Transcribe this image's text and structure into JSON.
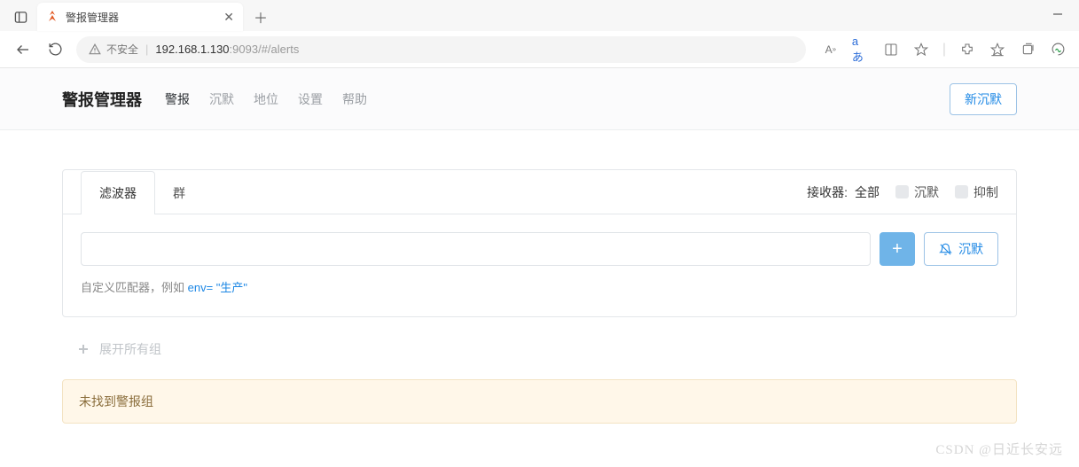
{
  "browser": {
    "tab_title": "警报管理器",
    "insecure_label": "不安全",
    "url_host": "192.168.1.130",
    "url_rest": ":9093/#/alerts",
    "text_size_label": "A",
    "translate_label": "aあ"
  },
  "nav": {
    "brand": "警报管理器",
    "links": {
      "alerts": "警报",
      "silences": "沉默",
      "status": "地位",
      "settings": "设置",
      "help": "帮助"
    },
    "new_silence": "新沉默"
  },
  "card": {
    "tab_filter": "滤波器",
    "tab_group": "群",
    "receiver_label": "接收器:",
    "receiver_value": "全部",
    "cb_silenced": "沉默",
    "cb_inhibited": "抑制",
    "add_label": "+",
    "silence_action": "沉默",
    "hint_prefix": "自定义匹配器，例如",
    "hint_example": " env= \"生产\""
  },
  "expand_label": "展开所有组",
  "warning_text": "未找到警报组",
  "watermark": "CSDN @日近长安远"
}
